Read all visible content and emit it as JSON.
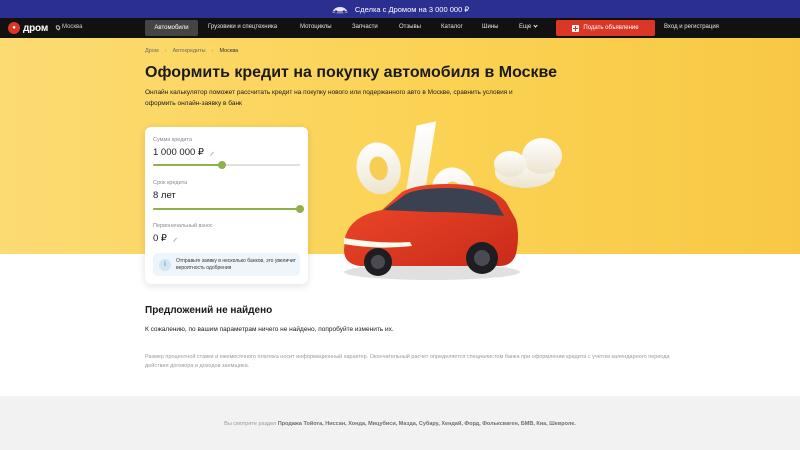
{
  "promo": {
    "text": "Сделка с Дромом на 3 000 000 ₽",
    "icon": "car-promo-icon"
  },
  "nav": {
    "logo_badge": "ДРОМ",
    "logo_text": "дром",
    "city": "Москва",
    "items": [
      "Автомобили",
      "Грузовики и спецтехника",
      "Мотоциклы",
      "Запчасти",
      "Отзывы",
      "Каталог",
      "Шины",
      "Еще"
    ],
    "post_button": "Подать объявление",
    "login": "Вход и регистрация"
  },
  "breadcrumb": {
    "items": [
      "Дром",
      "Автокредиты",
      "Москва"
    ]
  },
  "hero": {
    "title": "Оформить кредит на покупку автомобиля в Москве",
    "description": "Онлайн калькулятор поможет рассчитать кредит на покупку нового или подержанного авто в Москве, сравнить условия и оформить онлайн-заявку в банк"
  },
  "calculator": {
    "amount_label": "Сумма кредита",
    "amount_value": "1 000 000 ₽",
    "amount_level": 0.47,
    "term_label": "Срок кредита",
    "term_value": "8 лет",
    "term_level": 1.0,
    "down_label": "Первоначальный взнос",
    "down_value": "0 ₽",
    "hint": "Отправьте заявку в несколько банков, это увеличит вероятность одобрения",
    "accent_color": "#8fb04a"
  },
  "results": {
    "heading": "Предложений не найдено",
    "text": "К сожалению, по вашим параметрам ничего не найдено, попробуйте изменить их.",
    "disclaimer": "Размер процентной ставки и ежемесячного платежа носит информационный характер. Окончательный расчет определяется специалистом банка при оформлении кредита с учетом календарного периода действия договора и доходов заемщика."
  },
  "footer": {
    "prefix": "Вы смотрите раздел ",
    "brands": "Продажа Тойота, Ниссан, Хонда, Мицубиси, Мазда, Субару, Хендай, Форд, Фольксваген, БМВ, Киа, Шевроле."
  },
  "colors": {
    "brand_red": "#db3727",
    "nav_bg": "#111111",
    "promo_bg": "#2b2f8f",
    "hero_yellow": "#fbd253"
  }
}
